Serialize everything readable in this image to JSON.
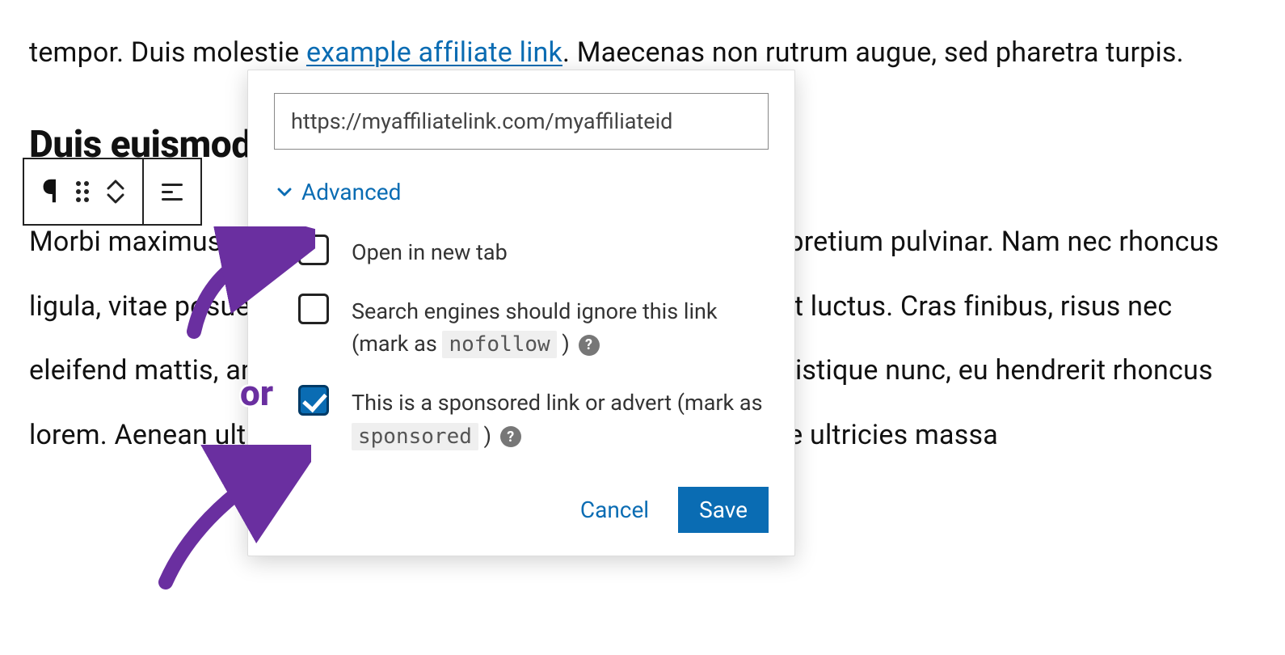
{
  "paragraph1": {
    "t1": "tempor. Duis molestie ",
    "link_text": "example affiliate link",
    "t2": ". Maecenas non rutrum augue, sed pharetra turpis."
  },
  "heading": "Duis euismod diam sed massa fermentum.",
  "paragraph2": "Morbi maximus purus quis metus consequat, vel dictum arcu pretium pulvinar. Nam nec rhoncus ligula, vitae posuere massa volutpat. Nulla efficitur vel purus ut luctus. Cras finibus, risus nec eleifend mattis, amet efficitur enim tristique. Nam dignissim tristique nunc, eu hendrerit rhoncus lorem. Aenean ultricies libero et hendrerit blandit. Pellentesque ultricies massa",
  "toolbar": {
    "paragraph_glyph": "¶"
  },
  "link_popover": {
    "url": "https://myaffiliatelink.com/myaffiliateid",
    "advanced_label": "Advanced",
    "options": {
      "newtab": {
        "checked": false,
        "label": "Open in new tab"
      },
      "nofollow": {
        "checked": false,
        "label_pre": "Search engines should ignore this link (mark as ",
        "code": "nofollow",
        "label_post": " )"
      },
      "sponsored": {
        "checked": true,
        "label_pre": "This is a sponsored link or advert (mark as ",
        "code": "sponsored",
        "label_post": " )"
      }
    },
    "cancel": "Cancel",
    "save": "Save"
  },
  "annotation": {
    "or": "or",
    "help_glyph": "?"
  },
  "colors": {
    "link": "#0a6cb3",
    "accent_purple": "#6a2fa0",
    "button_bg": "#0a6cb3"
  }
}
